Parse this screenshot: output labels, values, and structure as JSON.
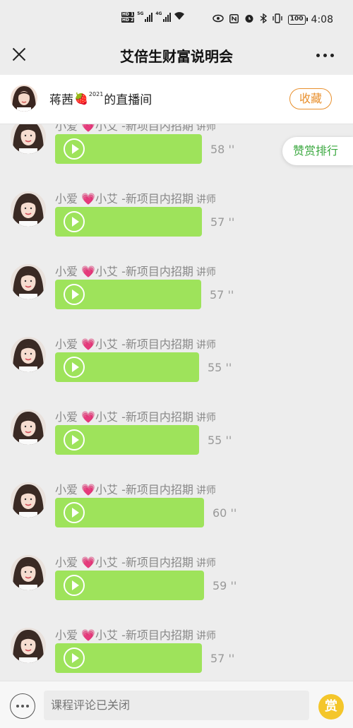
{
  "status_bar": {
    "hd1": "HD 1",
    "hd2": "HD 2",
    "net1": "5G",
    "net2": "4G",
    "battery": "100",
    "time": "4:08"
  },
  "nav": {
    "title": "艾倍生财富说明会",
    "close_icon": "close-icon",
    "more_icon": "more-icon"
  },
  "room": {
    "name_prefix": "蒋茜",
    "emoji": "🍓",
    "superscript": "2021",
    "name_suffix": "的直播间",
    "favorite_label": "收藏"
  },
  "reward_rank_label": "赞赏排行",
  "messages": [
    {
      "sender_a": "小爱 ",
      "heart": "💗",
      "sender_b": "小艾 -新项目内招期",
      "role": "讲师",
      "duration": "58 ''"
    },
    {
      "sender_a": "小爱 ",
      "heart": "💗",
      "sender_b": "小艾 -新项目内招期",
      "role": "讲师",
      "duration": "57 ''"
    },
    {
      "sender_a": "小爱 ",
      "heart": "💗",
      "sender_b": "小艾 -新项目内招期",
      "role": "讲师",
      "duration": "57 ''"
    },
    {
      "sender_a": "小爱 ",
      "heart": "💗",
      "sender_b": "小艾 -新项目内招期",
      "role": "讲师",
      "duration": "55 ''"
    },
    {
      "sender_a": "小爱 ",
      "heart": "💗",
      "sender_b": "小艾 -新项目内招期",
      "role": "讲师",
      "duration": "55 ''"
    },
    {
      "sender_a": "小爱 ",
      "heart": "💗",
      "sender_b": "小艾 -新项目内招期",
      "role": "讲师",
      "duration": "60 ''"
    },
    {
      "sender_a": "小爱 ",
      "heart": "💗",
      "sender_b": "小艾 -新项目内招期",
      "role": "讲师",
      "duration": "59 ''"
    },
    {
      "sender_a": "小爱 ",
      "heart": "💗",
      "sender_b": "小艾 -新项目内招期",
      "role": "讲师",
      "duration": "57 ''"
    }
  ],
  "bottom": {
    "comment_placeholder": "课程评论已关闭",
    "reward_label": "赏"
  },
  "colors": {
    "bubble": "#9ee35b",
    "accent_orange": "#e88f2c",
    "accent_green": "#3aa83f",
    "reward_yellow": "#f4c62b"
  }
}
